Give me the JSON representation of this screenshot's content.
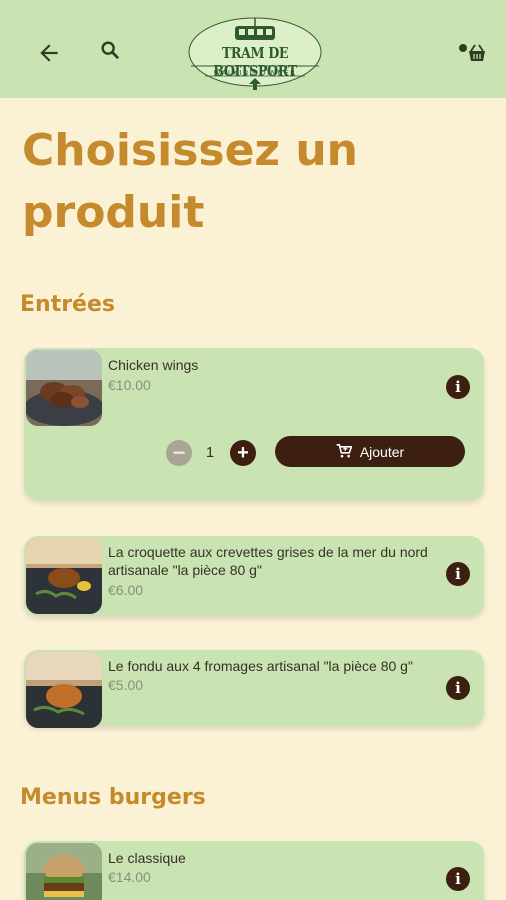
{
  "header": {
    "logo_title": "TRAM DE BOITSPORT",
    "logo_subtitle": "WALKING DINNER",
    "back_icon": "arrow-left-icon",
    "search_icon": "search-icon",
    "cart_icon": "user-cart-icon"
  },
  "page": {
    "title": "Choisissez un produit"
  },
  "sections": [
    {
      "title": "Entrées",
      "items": [
        {
          "name": "Chicken wings",
          "price": "€10.00",
          "quantity": "1",
          "add_label": "Ajouter"
        },
        {
          "name": "La croquette aux crevettes grises de la mer du nord artisanale \"la pièce 80 g\"",
          "price": "€6.00"
        },
        {
          "name": "Le fondu aux 4 fromages artisanal \"la pièce 80 g\"",
          "price": "€5.00"
        }
      ]
    },
    {
      "title": "Menus burgers",
      "items": [
        {
          "name": "Le classique",
          "price": "€14.00"
        }
      ]
    }
  ],
  "colors": {
    "header_bg": "#c9e3b2",
    "page_bg": "#fbf1d4",
    "accent": "#c48a2c",
    "dark_button": "#3d1f12"
  }
}
